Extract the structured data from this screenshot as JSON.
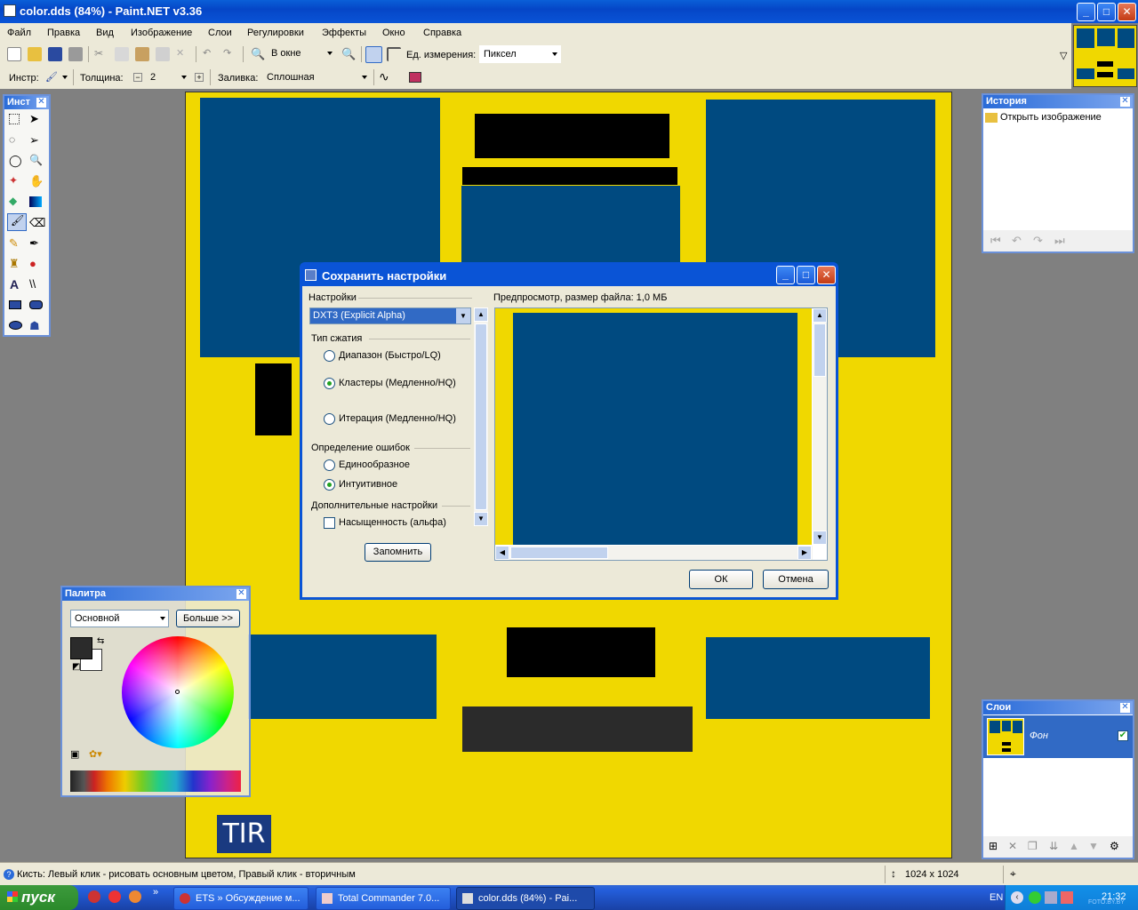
{
  "window": {
    "title": "color.dds (84%) - Paint.NET v3.36",
    "min": "_",
    "max": "□",
    "close": "✕"
  },
  "menu": [
    "Файл",
    "Правка",
    "Вид",
    "Изображение",
    "Слои",
    "Регулировки",
    "Эффекты",
    "Окно",
    "Справка"
  ],
  "toolbar": {
    "zoom_value": "В окне",
    "units_label": "Ед. измерения:",
    "units_value": "Пиксел"
  },
  "toolbar2": {
    "tool_label": "Инстр:",
    "width_label": "Толщина:",
    "width_value": "2",
    "fill_label": "Заливка:",
    "fill_value": "Сплошная"
  },
  "tools_panel": {
    "title": "Инст"
  },
  "history": {
    "title": "История",
    "items": [
      "Открыть изображение"
    ]
  },
  "layers": {
    "title": "Слои",
    "items": [
      {
        "name": "Фон",
        "visible": true
      }
    ]
  },
  "palette": {
    "title": "Палитра",
    "mode": "Основной",
    "more_button": "Больше >>"
  },
  "canvas": {
    "watermark": "TIR",
    "bg_color": "#f0d800",
    "blue": "#004a80"
  },
  "dialog": {
    "title": "Сохранить настройки",
    "settings_label": "Настройки",
    "format_value": "DXT3 (Explicit Alpha)",
    "compression_label": "Тип сжатия",
    "compression_options": [
      "Диапазон (Быстро/LQ)",
      "Кластеры (Медленно/HQ)",
      "Итерация (Медленно/HQ)"
    ],
    "compression_selected": 1,
    "error_label": "Определение ошибок",
    "error_options": [
      "Единообразное",
      "Интуитивное"
    ],
    "error_selected": 1,
    "extra_label": "Дополнительные настройки",
    "alpha_checkbox": "Насыщенность (альфа)",
    "remember_button": "Запомнить",
    "preview_label": "Предпросмотр, размер файла: 1,0 МБ",
    "ok_button": "ОК",
    "cancel_button": "Отмена"
  },
  "status": {
    "text": "Кисть: Левый клик - рисовать основным цветом, Правый клик - вторичным",
    "size": "1024 x 1024"
  },
  "taskbar": {
    "start": "пуск",
    "tasks": [
      "ETS » Обсуждение м...",
      "Total Commander 7.0...",
      "color.dds (84%) - Pai..."
    ],
    "lang": "EN",
    "clock": "21:32",
    "watermark": "FOTO.BY.BY"
  }
}
